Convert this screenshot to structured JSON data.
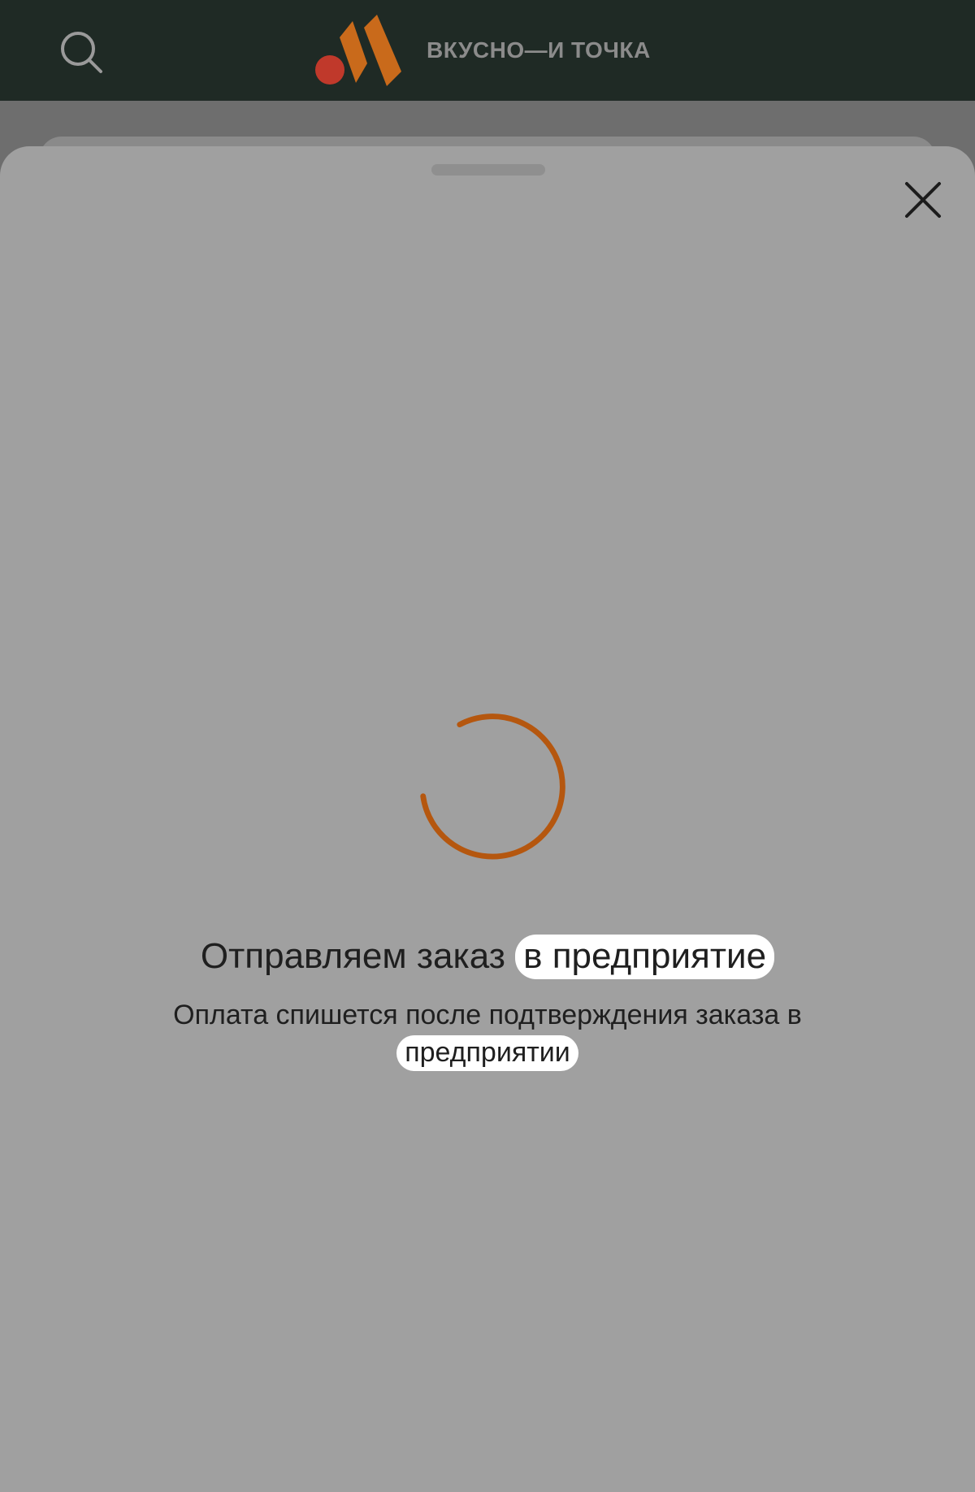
{
  "header": {
    "brand": "ВКУСНО—И ТОЧКА"
  },
  "sheet": {
    "title_prefix": "Отправляем заказ ",
    "title_highlight": "в предприятие",
    "subtitle_prefix": "Оплата спишется после подтверждения заказа в ",
    "subtitle_highlight": "предприятии"
  },
  "icons": {
    "search": "search-icon",
    "close": "close-icon",
    "spinner": "loading-spinner-icon",
    "logo": "brand-logo-icon"
  },
  "colors": {
    "topbar": "#1f2a25",
    "spinner": "#b5570f",
    "logo_red": "#c0392b",
    "logo_orange": "#c96a1b",
    "sheet": "#a0a0a0",
    "highlight": "#ffffff"
  }
}
